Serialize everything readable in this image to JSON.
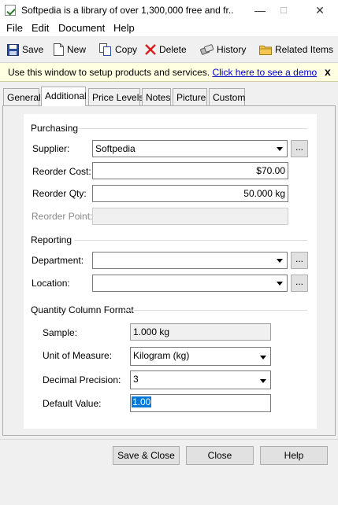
{
  "window": {
    "title": "Softpedia is a library of over 1,300,000 free and fr...",
    "minimize": "—",
    "maximize": "□",
    "close": "✕"
  },
  "menu": [
    "File",
    "Edit",
    "Document",
    "Help"
  ],
  "toolbar": {
    "save": "Save",
    "new": "New",
    "copy": "Copy",
    "delete": "Delete",
    "history": "History",
    "related": "Related Items"
  },
  "info": {
    "text": "Use this window to setup products and services.",
    "link": "Click here to see a demo",
    "close": "x"
  },
  "tabs": [
    "General",
    "Additional",
    "Price Levels",
    "Notes",
    "Picture",
    "Custom"
  ],
  "active_tab": "Additional",
  "purchasing": {
    "title": "Purchasing",
    "supplier_label": "Supplier:",
    "supplier_value": "Softpedia",
    "reorder_cost_label": "Reorder Cost:",
    "reorder_cost_value": "$70.00",
    "reorder_qty_label": "Reorder Qty:",
    "reorder_qty_value": "50.000 kg",
    "reorder_point_label": "Reorder Point:",
    "reorder_point_value": ""
  },
  "reporting": {
    "title": "Reporting",
    "department_label": "Department:",
    "department_value": "",
    "location_label": "Location:",
    "location_value": ""
  },
  "quantity_format": {
    "title": "Quantity Column Format",
    "sample_label": "Sample:",
    "sample_value": "1.000 kg",
    "unit_label": "Unit of Measure:",
    "unit_value": "Kilogram (kg)",
    "precision_label": "Decimal Precision:",
    "precision_value": "3",
    "default_label": "Default Value:",
    "default_value": "1.00"
  },
  "ellipsis": "...",
  "buttons": {
    "save_close": "Save & Close",
    "close": "Close",
    "help": "Help"
  },
  "colors": {
    "info_background": "#ffffe1",
    "link": "#0000cc",
    "selection": "#0078d7"
  }
}
